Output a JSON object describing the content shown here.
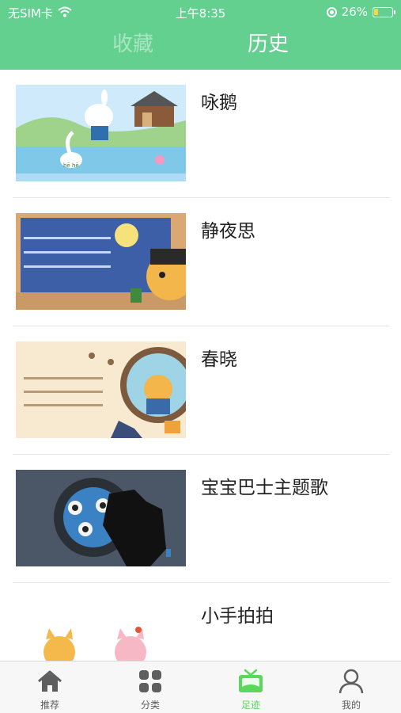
{
  "status_bar": {
    "carrier": "无SIM卡",
    "time": "上午8:35",
    "battery_percent": "26%",
    "battery_level": 0.26,
    "icons": [
      "wifi-icon",
      "orientation-lock-icon",
      "battery-charging-icon"
    ]
  },
  "header": {
    "tabs": [
      {
        "label": "收藏",
        "active": false
      },
      {
        "label": "历史",
        "active": true
      }
    ],
    "colors": {
      "background": "#63d08f",
      "active_tab": "#ffffff",
      "inactive_tab": "#a8e6c1"
    }
  },
  "history": {
    "items": [
      {
        "title": "咏鹅",
        "thumb_caption": "hē   hē"
      },
      {
        "title": "静夜思"
      },
      {
        "title": "春晓"
      },
      {
        "title": "宝宝巴士主题歌"
      },
      {
        "title": "小手拍拍"
      }
    ]
  },
  "bottom_nav": {
    "items": [
      {
        "label": "推荐",
        "icon": "home-icon",
        "active": false
      },
      {
        "label": "分类",
        "icon": "grid-icon",
        "active": false
      },
      {
        "label": "足迹",
        "icon": "tv-icon",
        "active": true
      },
      {
        "label": "我的",
        "icon": "user-icon",
        "active": false
      }
    ],
    "colors": {
      "active": "#5bd85b",
      "inactive": "#5e5e5e"
    }
  }
}
